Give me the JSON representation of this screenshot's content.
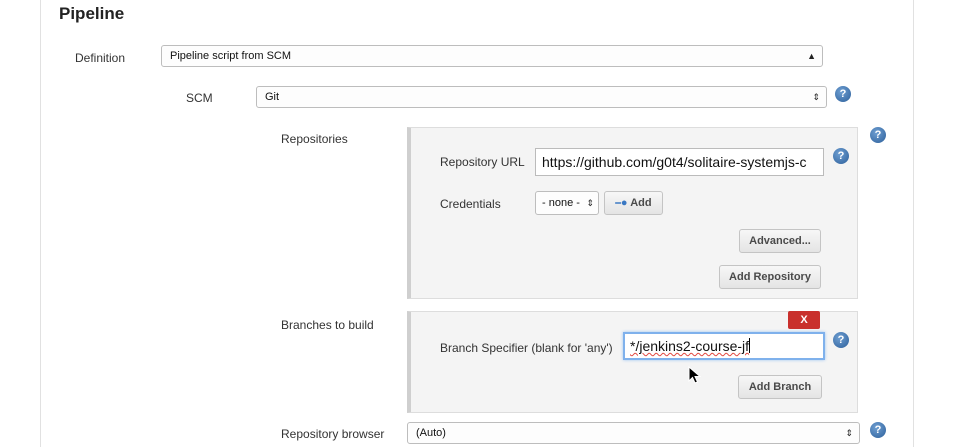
{
  "section": {
    "title": "Pipeline"
  },
  "definition": {
    "label": "Definition",
    "value": "Pipeline script from SCM"
  },
  "scm": {
    "label": "SCM",
    "value": "Git"
  },
  "repositories": {
    "label": "Repositories",
    "url_label": "Repository URL",
    "url_value": "https://github.com/g0t4/solitaire-systemjs-c",
    "credentials_label": "Credentials",
    "credentials_value": "- none -",
    "add_label": "Add",
    "advanced_label": "Advanced...",
    "add_repository_label": "Add Repository"
  },
  "branches": {
    "label": "Branches to build",
    "delete_label": "X",
    "specifier_label": "Branch Specifier (blank for 'any')",
    "specifier_value": "*/jenkins2-course-jf",
    "add_branch_label": "Add Branch"
  },
  "repository_browser": {
    "label": "Repository browser",
    "value": "(Auto)"
  },
  "icons": {
    "help": "help-icon",
    "select_arrows": "updown-arrows-icon",
    "key": "key-icon",
    "cursor": "mouse-pointer-icon"
  },
  "colors": {
    "help_blue": "#2c5f9a",
    "delete_red": "#c9302c",
    "focus_blue": "#7fb1ec"
  }
}
